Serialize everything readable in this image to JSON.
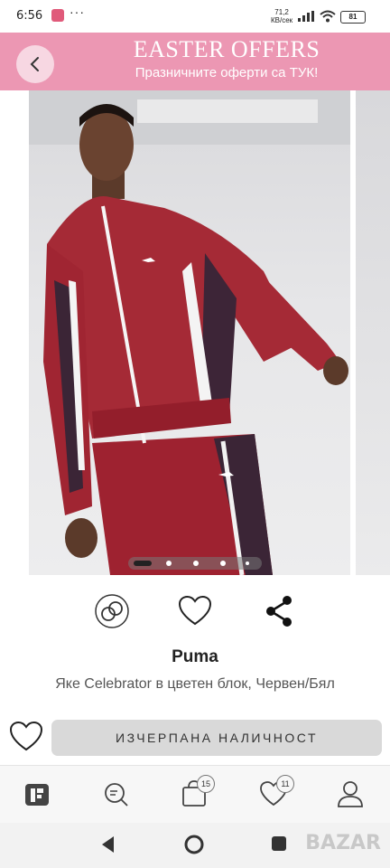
{
  "status_bar": {
    "time": "6:56",
    "notification_badge": "",
    "more": "···",
    "network_speed": "71,2",
    "network_unit": "КВ/сек",
    "battery": "81"
  },
  "banner": {
    "title": "EASTER OFFERS",
    "subtitle": "Празничните оферти са ТУК!",
    "back_icon": "chevron-left-icon",
    "bg_color": "#ec97b3"
  },
  "gallery": {
    "image_count": 5,
    "active_index": 0
  },
  "actions": [
    {
      "name": "compare-icon"
    },
    {
      "name": "heart-icon"
    },
    {
      "name": "share-icon"
    }
  ],
  "product": {
    "brand": "Puma",
    "name": "Яке Celebrator в цветен блок, Червен/Бял"
  },
  "buy": {
    "soldout_label": "ИЗЧЕРПАНА НАЛИЧНОСТ"
  },
  "bottom_nav": {
    "items": [
      {
        "name": "home",
        "icon": "brand-logo-icon"
      },
      {
        "name": "search",
        "icon": "search-icon"
      },
      {
        "name": "bag",
        "icon": "bag-icon",
        "badge": "15"
      },
      {
        "name": "wishlist",
        "icon": "heart-icon",
        "badge": "11"
      },
      {
        "name": "account",
        "icon": "user-icon"
      }
    ]
  },
  "watermark": "BAZAR"
}
